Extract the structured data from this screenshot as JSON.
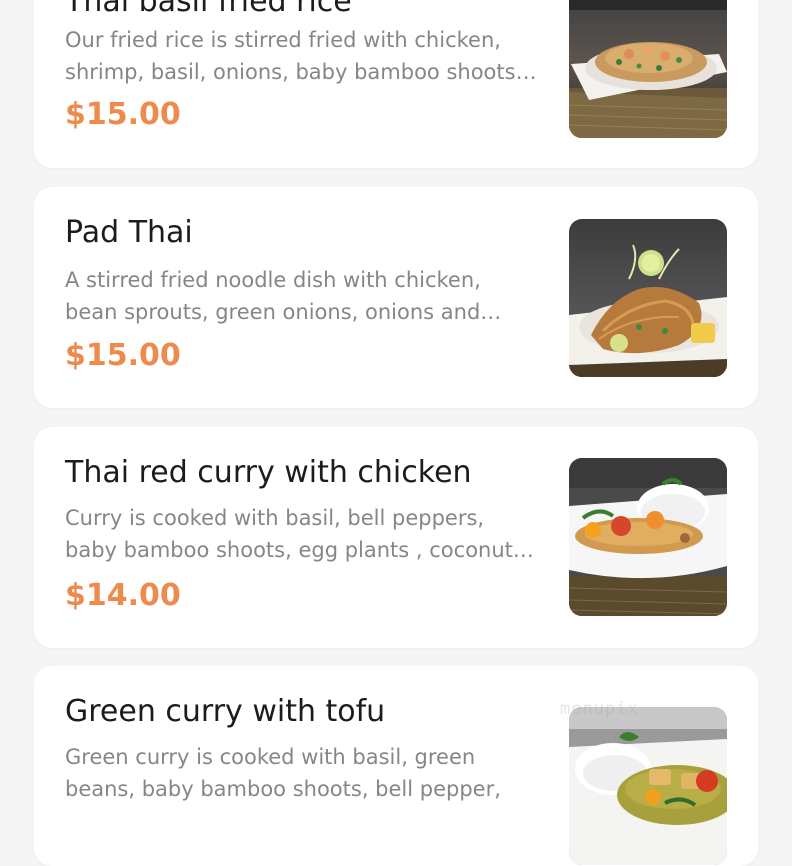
{
  "menu": {
    "items": [
      {
        "name": "Thai basil fried rice",
        "description_lines": [
          "Our fried rice is stirred fried with chicken,",
          "shrimp, basil, onions, baby bamboo shoots…"
        ],
        "price": "$15.00",
        "photo": "basil-fried-rice-photo"
      },
      {
        "name": "Pad Thai",
        "description_lines": [
          "A stirred fried noodle dish with chicken,",
          "bean sprouts, green onions, onions and…"
        ],
        "price": "$15.00",
        "photo": "pad-thai-photo"
      },
      {
        "name": "Thai red curry with chicken",
        "description_lines": [
          "Curry is cooked with basil, bell peppers,",
          "baby bamboo shoots, egg plants , coconut…"
        ],
        "price": "$14.00",
        "photo": "red-curry-photo"
      },
      {
        "name": "Green curry with tofu",
        "description_lines": [
          "Green curry is cooked with basil, green",
          "beans, baby bamboo shoots, bell pepper,"
        ],
        "photo": "green-curry-photo"
      }
    ]
  },
  "watermark": "menupix",
  "colors": {
    "price": "#ef8a4d",
    "title": "#1c1c1c",
    "description": "#868686",
    "card": "#ffffff",
    "background": "#f5f5f5"
  }
}
